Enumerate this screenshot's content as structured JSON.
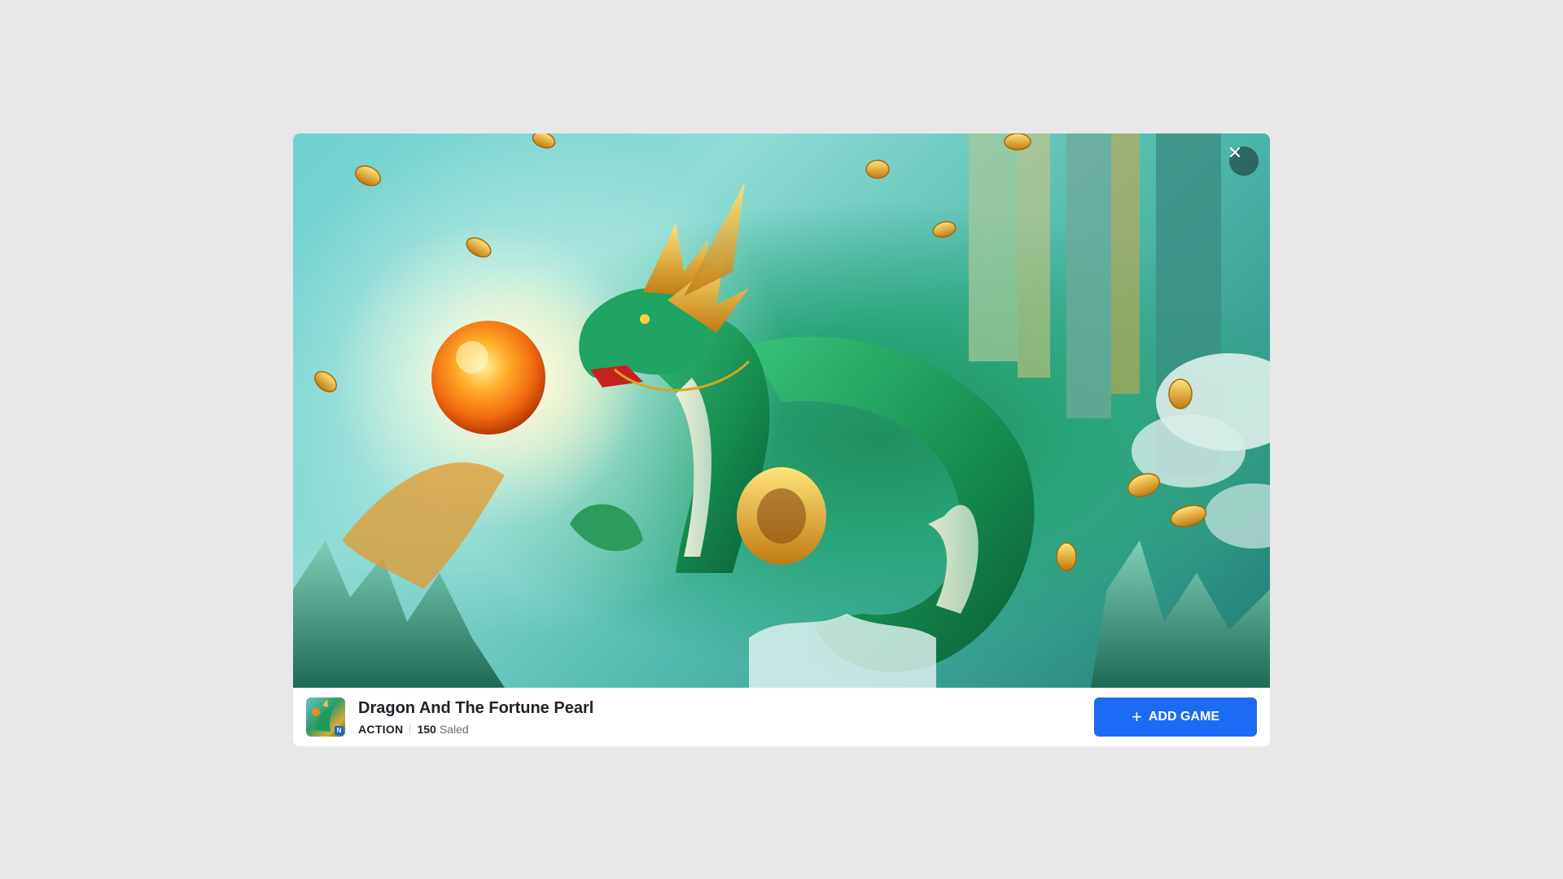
{
  "game": {
    "title": "Dragon And The Fortune Pearl",
    "genre": "ACTION",
    "sold_count": "150",
    "sold_label": "Saled"
  },
  "actions": {
    "add_game_label": "ADD GAME",
    "add_icon": "+",
    "close_icon": "✕"
  },
  "colors": {
    "accent": "#1c6bf5",
    "background": "#e8e8e8"
  },
  "icons": [
    "close-icon",
    "plus-icon"
  ]
}
